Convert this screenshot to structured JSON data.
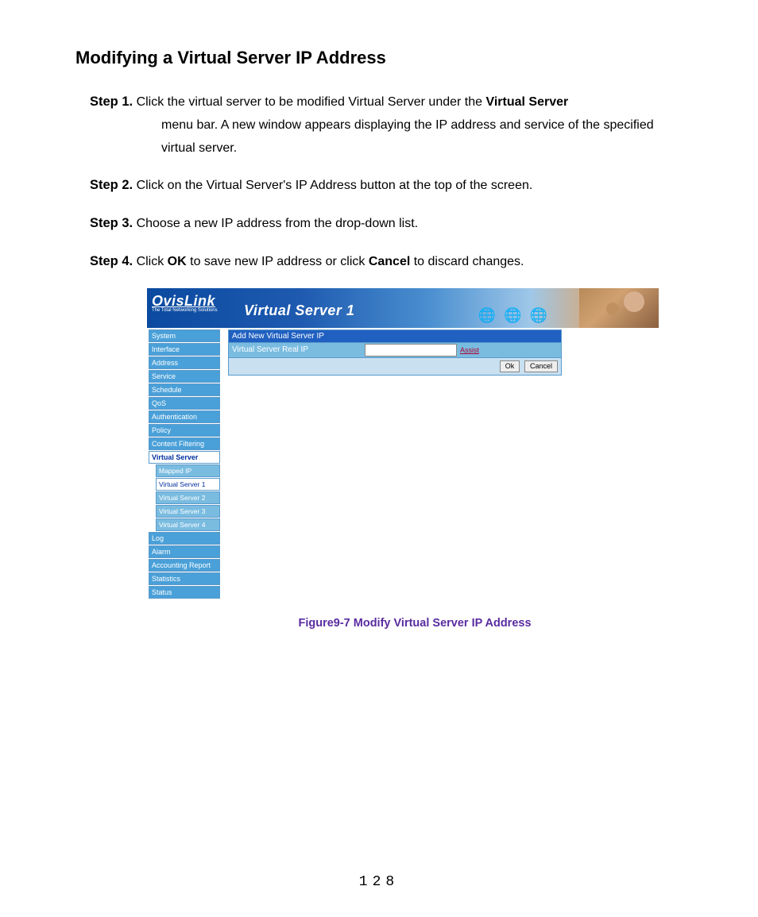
{
  "title": "Modifying a Virtual Server IP Address",
  "steps": [
    {
      "label": "Step 1.",
      "pre": "Click the virtual server to be modified Virtual Server under the ",
      "bold": "Virtual Server",
      "post": " menu bar. A new window appears displaying the IP address and service of the specified virtual server."
    },
    {
      "label": "Step 2.",
      "text": "Click on the Virtual Server's IP Address button at the top of the screen."
    },
    {
      "label": "Step 3.",
      "text": "Choose a new IP address from the drop-down list."
    },
    {
      "label": "Step 4.",
      "pre": "Click ",
      "bold": "OK",
      "mid": " to save new IP address or click ",
      "bold2": "Cancel",
      "post": " to discard changes."
    }
  ],
  "screenshot": {
    "brand_name": "OvisLink",
    "brand_tag": "The Total Networking Solutions",
    "banner_title": "Virtual Server 1",
    "nav": [
      {
        "label": "System"
      },
      {
        "label": "Interface"
      },
      {
        "label": "Address"
      },
      {
        "label": "Service"
      },
      {
        "label": "Schedule"
      },
      {
        "label": "QoS"
      },
      {
        "label": "Authentication"
      },
      {
        "label": "Policy"
      },
      {
        "label": "Content Filtering"
      },
      {
        "label": "Virtual Server",
        "active": true,
        "subs": [
          {
            "label": "Mapped IP"
          },
          {
            "label": "Virtual Server 1",
            "active": true
          },
          {
            "label": "Virtual Server 2"
          },
          {
            "label": "Virtual Server 3"
          },
          {
            "label": "Virtual Server 4"
          }
        ]
      },
      {
        "label": "Log"
      },
      {
        "label": "Alarm"
      },
      {
        "label": "Accounting Report"
      },
      {
        "label": "Statistics"
      },
      {
        "label": "Status"
      }
    ],
    "form": {
      "header": "Add New Virtual Server IP",
      "row_label": "Virtual Server Real IP",
      "ip_value": "",
      "assist": "Assist",
      "ok": "Ok",
      "cancel": "Cancel"
    }
  },
  "caption": "Figure9-7 Modify Virtual Server IP Address",
  "page_number": "128"
}
